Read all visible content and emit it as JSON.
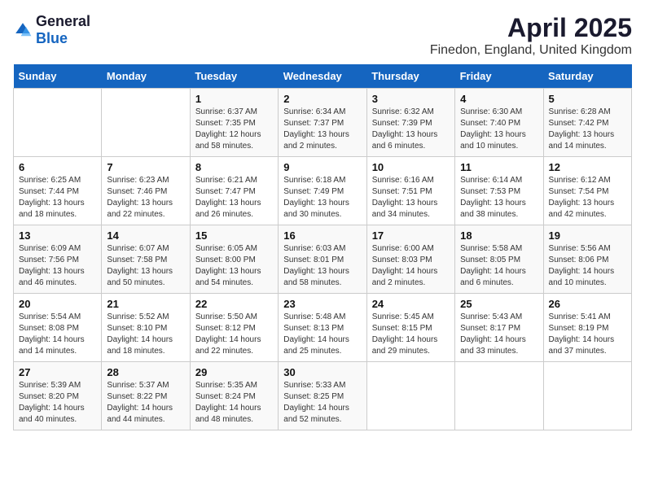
{
  "header": {
    "logo_general": "General",
    "logo_blue": "Blue",
    "title": "April 2025",
    "subtitle": "Finedon, England, United Kingdom"
  },
  "calendar": {
    "weekdays": [
      "Sunday",
      "Monday",
      "Tuesday",
      "Wednesday",
      "Thursday",
      "Friday",
      "Saturday"
    ],
    "weeks": [
      [
        {
          "day": "",
          "sunrise": "",
          "sunset": "",
          "daylight": ""
        },
        {
          "day": "",
          "sunrise": "",
          "sunset": "",
          "daylight": ""
        },
        {
          "day": "1",
          "sunrise": "Sunrise: 6:37 AM",
          "sunset": "Sunset: 7:35 PM",
          "daylight": "Daylight: 12 hours and 58 minutes."
        },
        {
          "day": "2",
          "sunrise": "Sunrise: 6:34 AM",
          "sunset": "Sunset: 7:37 PM",
          "daylight": "Daylight: 13 hours and 2 minutes."
        },
        {
          "day": "3",
          "sunrise": "Sunrise: 6:32 AM",
          "sunset": "Sunset: 7:39 PM",
          "daylight": "Daylight: 13 hours and 6 minutes."
        },
        {
          "day": "4",
          "sunrise": "Sunrise: 6:30 AM",
          "sunset": "Sunset: 7:40 PM",
          "daylight": "Daylight: 13 hours and 10 minutes."
        },
        {
          "day": "5",
          "sunrise": "Sunrise: 6:28 AM",
          "sunset": "Sunset: 7:42 PM",
          "daylight": "Daylight: 13 hours and 14 minutes."
        }
      ],
      [
        {
          "day": "6",
          "sunrise": "Sunrise: 6:25 AM",
          "sunset": "Sunset: 7:44 PM",
          "daylight": "Daylight: 13 hours and 18 minutes."
        },
        {
          "day": "7",
          "sunrise": "Sunrise: 6:23 AM",
          "sunset": "Sunset: 7:46 PM",
          "daylight": "Daylight: 13 hours and 22 minutes."
        },
        {
          "day": "8",
          "sunrise": "Sunrise: 6:21 AM",
          "sunset": "Sunset: 7:47 PM",
          "daylight": "Daylight: 13 hours and 26 minutes."
        },
        {
          "day": "9",
          "sunrise": "Sunrise: 6:18 AM",
          "sunset": "Sunset: 7:49 PM",
          "daylight": "Daylight: 13 hours and 30 minutes."
        },
        {
          "day": "10",
          "sunrise": "Sunrise: 6:16 AM",
          "sunset": "Sunset: 7:51 PM",
          "daylight": "Daylight: 13 hours and 34 minutes."
        },
        {
          "day": "11",
          "sunrise": "Sunrise: 6:14 AM",
          "sunset": "Sunset: 7:53 PM",
          "daylight": "Daylight: 13 hours and 38 minutes."
        },
        {
          "day": "12",
          "sunrise": "Sunrise: 6:12 AM",
          "sunset": "Sunset: 7:54 PM",
          "daylight": "Daylight: 13 hours and 42 minutes."
        }
      ],
      [
        {
          "day": "13",
          "sunrise": "Sunrise: 6:09 AM",
          "sunset": "Sunset: 7:56 PM",
          "daylight": "Daylight: 13 hours and 46 minutes."
        },
        {
          "day": "14",
          "sunrise": "Sunrise: 6:07 AM",
          "sunset": "Sunset: 7:58 PM",
          "daylight": "Daylight: 13 hours and 50 minutes."
        },
        {
          "day": "15",
          "sunrise": "Sunrise: 6:05 AM",
          "sunset": "Sunset: 8:00 PM",
          "daylight": "Daylight: 13 hours and 54 minutes."
        },
        {
          "day": "16",
          "sunrise": "Sunrise: 6:03 AM",
          "sunset": "Sunset: 8:01 PM",
          "daylight": "Daylight: 13 hours and 58 minutes."
        },
        {
          "day": "17",
          "sunrise": "Sunrise: 6:00 AM",
          "sunset": "Sunset: 8:03 PM",
          "daylight": "Daylight: 14 hours and 2 minutes."
        },
        {
          "day": "18",
          "sunrise": "Sunrise: 5:58 AM",
          "sunset": "Sunset: 8:05 PM",
          "daylight": "Daylight: 14 hours and 6 minutes."
        },
        {
          "day": "19",
          "sunrise": "Sunrise: 5:56 AM",
          "sunset": "Sunset: 8:06 PM",
          "daylight": "Daylight: 14 hours and 10 minutes."
        }
      ],
      [
        {
          "day": "20",
          "sunrise": "Sunrise: 5:54 AM",
          "sunset": "Sunset: 8:08 PM",
          "daylight": "Daylight: 14 hours and 14 minutes."
        },
        {
          "day": "21",
          "sunrise": "Sunrise: 5:52 AM",
          "sunset": "Sunset: 8:10 PM",
          "daylight": "Daylight: 14 hours and 18 minutes."
        },
        {
          "day": "22",
          "sunrise": "Sunrise: 5:50 AM",
          "sunset": "Sunset: 8:12 PM",
          "daylight": "Daylight: 14 hours and 22 minutes."
        },
        {
          "day": "23",
          "sunrise": "Sunrise: 5:48 AM",
          "sunset": "Sunset: 8:13 PM",
          "daylight": "Daylight: 14 hours and 25 minutes."
        },
        {
          "day": "24",
          "sunrise": "Sunrise: 5:45 AM",
          "sunset": "Sunset: 8:15 PM",
          "daylight": "Daylight: 14 hours and 29 minutes."
        },
        {
          "day": "25",
          "sunrise": "Sunrise: 5:43 AM",
          "sunset": "Sunset: 8:17 PM",
          "daylight": "Daylight: 14 hours and 33 minutes."
        },
        {
          "day": "26",
          "sunrise": "Sunrise: 5:41 AM",
          "sunset": "Sunset: 8:19 PM",
          "daylight": "Daylight: 14 hours and 37 minutes."
        }
      ],
      [
        {
          "day": "27",
          "sunrise": "Sunrise: 5:39 AM",
          "sunset": "Sunset: 8:20 PM",
          "daylight": "Daylight: 14 hours and 40 minutes."
        },
        {
          "day": "28",
          "sunrise": "Sunrise: 5:37 AM",
          "sunset": "Sunset: 8:22 PM",
          "daylight": "Daylight: 14 hours and 44 minutes."
        },
        {
          "day": "29",
          "sunrise": "Sunrise: 5:35 AM",
          "sunset": "Sunset: 8:24 PM",
          "daylight": "Daylight: 14 hours and 48 minutes."
        },
        {
          "day": "30",
          "sunrise": "Sunrise: 5:33 AM",
          "sunset": "Sunset: 8:25 PM",
          "daylight": "Daylight: 14 hours and 52 minutes."
        },
        {
          "day": "",
          "sunrise": "",
          "sunset": "",
          "daylight": ""
        },
        {
          "day": "",
          "sunrise": "",
          "sunset": "",
          "daylight": ""
        },
        {
          "day": "",
          "sunrise": "",
          "sunset": "",
          "daylight": ""
        }
      ]
    ]
  }
}
